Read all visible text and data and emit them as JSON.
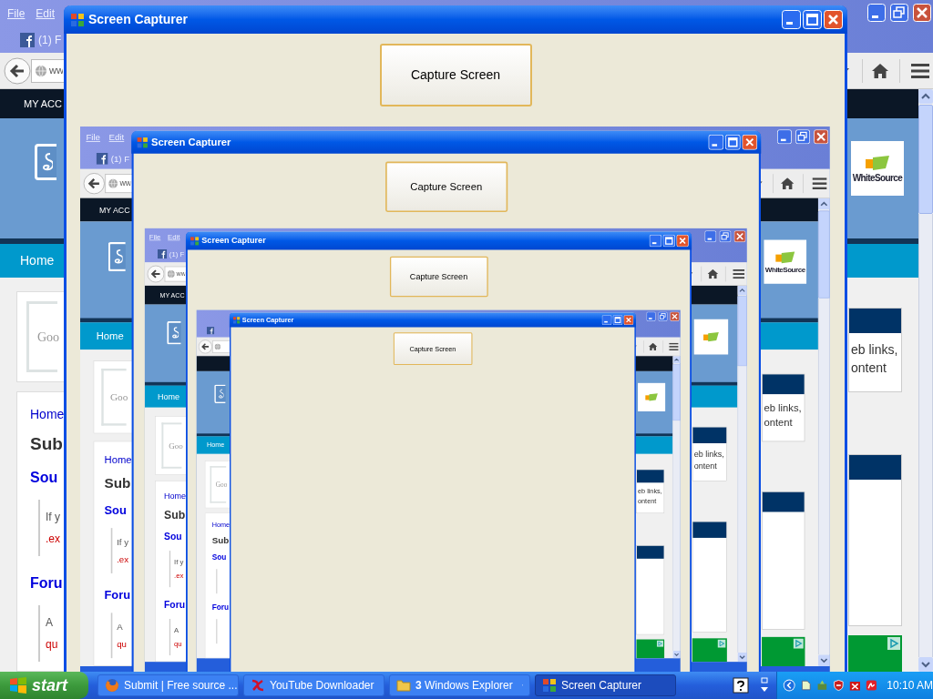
{
  "screen": {
    "browser": {
      "menu": [
        "File",
        "Edit"
      ],
      "tab": "(1) F",
      "address": "ww",
      "account_link": "MY ACC",
      "nav_link": "Home",
      "search_hint": "Goo",
      "breadcrumb": "Home",
      "heading": "Sub",
      "sections": [
        {
          "title": "Sou",
          "lines": [
            {
              "text": "If y",
              "kind": "plain"
            },
            {
              "text": ".ex",
              "kind": "link"
            }
          ]
        },
        {
          "title": "Foru",
          "lines": [
            {
              "text": "A",
              "kind": "plain"
            },
            {
              "text": "qu",
              "kind": "link"
            }
          ]
        }
      ],
      "sidebar_lines": [
        "eb links,",
        "ontent"
      ],
      "sponsor": "WhiteSource"
    },
    "capturer": {
      "title": "Screen Capturer",
      "button": "Capture Screen",
      "capture": {
        "browser": {
          "menu": [
            "File",
            "Edit"
          ],
          "tab": "(1) F",
          "address": "ww",
          "account_link": "MY ACC",
          "nav_link": "Home",
          "search_hint": "Goo",
          "breadcrumb": "Home",
          "heading": "Sub",
          "sections": [
            {
              "title": "Sou",
              "lines": [
                {
                  "text": "If y",
                  "kind": "plain"
                },
                {
                  "text": ".ex",
                  "kind": "link"
                }
              ]
            },
            {
              "title": "Foru",
              "lines": [
                {
                  "text": "A",
                  "kind": "plain"
                },
                {
                  "text": "qu",
                  "kind": "link"
                }
              ]
            }
          ],
          "sidebar_lines": [
            "eb links,",
            "ontent"
          ],
          "sponsor": "WhiteSource"
        },
        "capturer": {
          "title": "Screen Capturer",
          "button": "Capture Screen",
          "capture": {
            "browser": {
              "menu": [
                "File",
                "Edit"
              ],
              "tab": "(1) F",
              "address": "ww",
              "account_link": "MY ACC",
              "nav_link": "Home",
              "search_hint": "Goo",
              "breadcrumb": "Home",
              "heading": "Sub",
              "sections": [
                {
                  "title": "Sou",
                  "lines": [
                    {
                      "text": "If y",
                      "kind": "plain"
                    },
                    {
                      "text": ".ex",
                      "kind": "link"
                    }
                  ]
                },
                {
                  "title": "Foru",
                  "lines": [
                    {
                      "text": "A",
                      "kind": "plain"
                    },
                    {
                      "text": "qu",
                      "kind": "link"
                    }
                  ]
                }
              ],
              "sidebar_lines": [
                "eb links,",
                "ontent"
              ]
            },
            "capturer": {
              "title": "Screen Capturer",
              "button": "Capture Screen",
              "capture": {
                "browser": {
                  "nav_link": "Home",
                  "search_hint": "Goo",
                  "breadcrumb": "Home",
                  "heading": "Sub",
                  "sections": [
                    {
                      "title": "Sou"
                    },
                    {
                      "title": "Foru"
                    }
                  ],
                  "sidebar_lines": [
                    "eb links,",
                    "ontent"
                  ]
                },
                "capturer": {
                  "title": "Screen Capturer",
                  "button": "Capture Screen"
                }
              }
            }
          }
        }
      }
    }
  },
  "taskbar": {
    "start": "start",
    "items": [
      {
        "label": "Submit | Free source ...",
        "kind": "firefox",
        "selected": false
      },
      {
        "label": "YouTube Downloader",
        "kind": "app",
        "selected": false
      },
      {
        "label": "**3** Windows Explorer",
        "kind": "folder",
        "selected": false
      },
      {
        "label": "Screen Capturer",
        "kind": "capturer",
        "selected": true
      }
    ],
    "clock": "10:10 AM"
  }
}
